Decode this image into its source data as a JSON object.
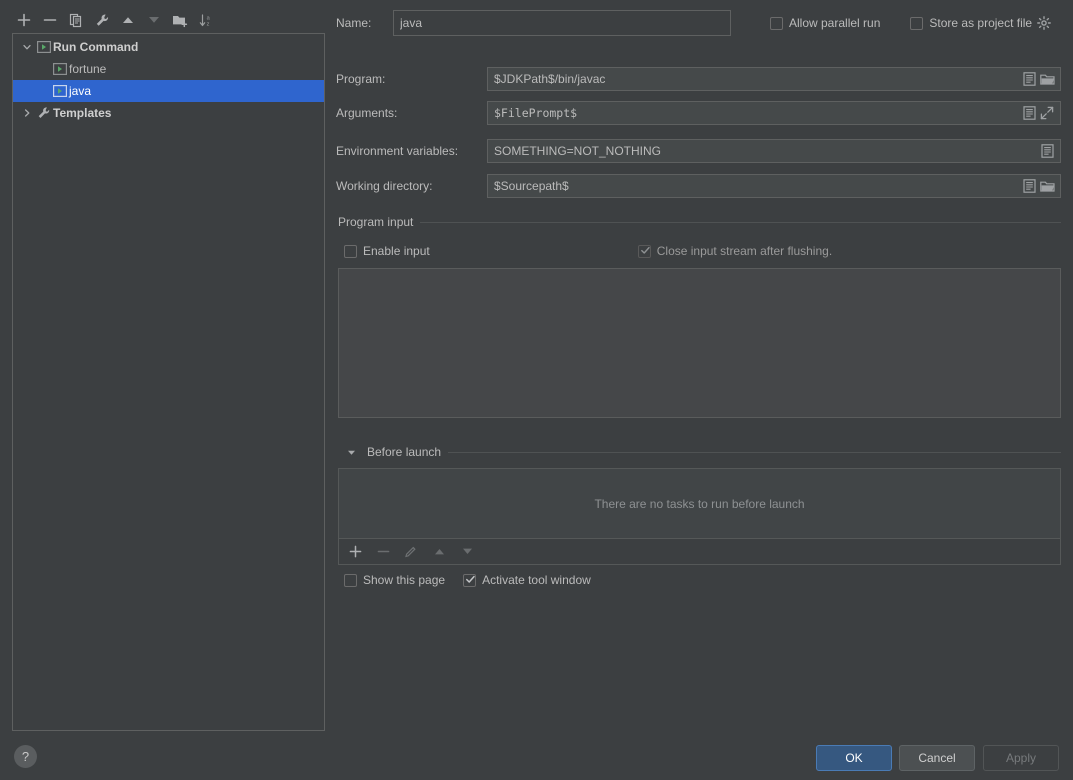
{
  "left_panel": {
    "toolbar": [
      {
        "name": "add-configuration-button",
        "icon": "plus-icon",
        "tooltip": "Add New Configuration",
        "enabled": true
      },
      {
        "name": "remove-configuration-button",
        "icon": "minus-icon",
        "tooltip": "Remove Configuration",
        "enabled": true
      },
      {
        "name": "copy-configuration-button",
        "icon": "copy-icon",
        "tooltip": "Copy Configuration",
        "enabled": true
      },
      {
        "name": "edit-templates-button",
        "icon": "wrench-icon",
        "tooltip": "Edit Templates",
        "enabled": true
      },
      {
        "name": "move-up-button",
        "icon": "arrow-up-icon",
        "tooltip": "Move Up",
        "enabled": true
      },
      {
        "name": "move-down-button",
        "icon": "arrow-down-icon",
        "tooltip": "Move Down",
        "enabled": false
      },
      {
        "name": "move-into-folder-button",
        "icon": "folder-add-icon",
        "tooltip": "Create New Folder",
        "enabled": true
      },
      {
        "name": "sort-configurations-button",
        "icon": "sort-az-icon",
        "tooltip": "Sort Configurations",
        "enabled": true
      }
    ],
    "tree": [
      {
        "label": "Run Command",
        "icon": "run-config-icon",
        "level": 0,
        "expanded": true,
        "bold": true,
        "selected": false
      },
      {
        "label": "fortune",
        "icon": "run-config-icon",
        "level": 1,
        "expanded": null,
        "bold": false,
        "selected": false
      },
      {
        "label": "java",
        "icon": "run-config-icon",
        "level": 1,
        "expanded": null,
        "bold": false,
        "selected": true
      },
      {
        "label": "Templates",
        "icon": "wrench-icon",
        "level": 0,
        "expanded": false,
        "bold": true,
        "selected": false
      }
    ]
  },
  "form": {
    "name_label": "Name:",
    "name_value": "java",
    "allow_parallel_run": {
      "label": "Allow parallel run",
      "checked": false
    },
    "store_as_project_file": {
      "label": "Store as project file",
      "checked": false,
      "gear_icon": "gear-icon"
    },
    "fields": [
      {
        "name": "program",
        "label": "Program:",
        "value": "$JDKPath$/bin/javac",
        "actions": [
          "macro-list-icon",
          "browse-folder-icon"
        ]
      },
      {
        "name": "arguments",
        "label": "Arguments:",
        "value": "$FilePrompt$",
        "mono": true,
        "actions": [
          "macro-list-icon",
          "expand-icon"
        ]
      },
      {
        "name": "environment-variables",
        "label": "Environment variables:",
        "value": "SOMETHING=NOT_NOTHING",
        "actions": [
          "macro-list-icon"
        ]
      },
      {
        "name": "working-directory",
        "label": "Working directory:",
        "value": "$Sourcepath$",
        "actions": [
          "macro-list-icon",
          "browse-folder-icon"
        ]
      }
    ],
    "program_input": {
      "group_title": "Program input",
      "enable_input": {
        "label": "Enable input",
        "checked": false
      },
      "close_input_stream": {
        "label": "Close input stream after flushing.",
        "checked": true,
        "disabled": true
      },
      "textarea_value": ""
    },
    "before_launch": {
      "group_title": "Before launch",
      "expanded": true,
      "empty_text": "There are no tasks to run before launch",
      "toolbar": [
        {
          "name": "add-task-button",
          "icon": "plus-icon",
          "enabled": true
        },
        {
          "name": "remove-task-button",
          "icon": "minus-icon",
          "enabled": false
        },
        {
          "name": "edit-task-button",
          "icon": "pencil-icon",
          "enabled": false
        },
        {
          "name": "task-move-up-button",
          "icon": "arrow-up-icon",
          "enabled": false
        },
        {
          "name": "task-move-down-button",
          "icon": "arrow-down-icon",
          "enabled": false
        }
      ],
      "show_this_page": {
        "label": "Show this page",
        "checked": false
      },
      "activate_tool_window": {
        "label": "Activate tool window",
        "checked": true
      }
    }
  },
  "footer": {
    "help_label": "?",
    "ok_label": "OK",
    "cancel_label": "Cancel",
    "apply_label": "Apply",
    "apply_enabled": false
  },
  "colors": {
    "dialog_bg": "#3C3F41",
    "selection_blue": "#2F65CE",
    "primary_button": "#365880",
    "field_bg": "#45494A",
    "text": "#BBBBBB",
    "run_icon_green": "#59A869"
  }
}
